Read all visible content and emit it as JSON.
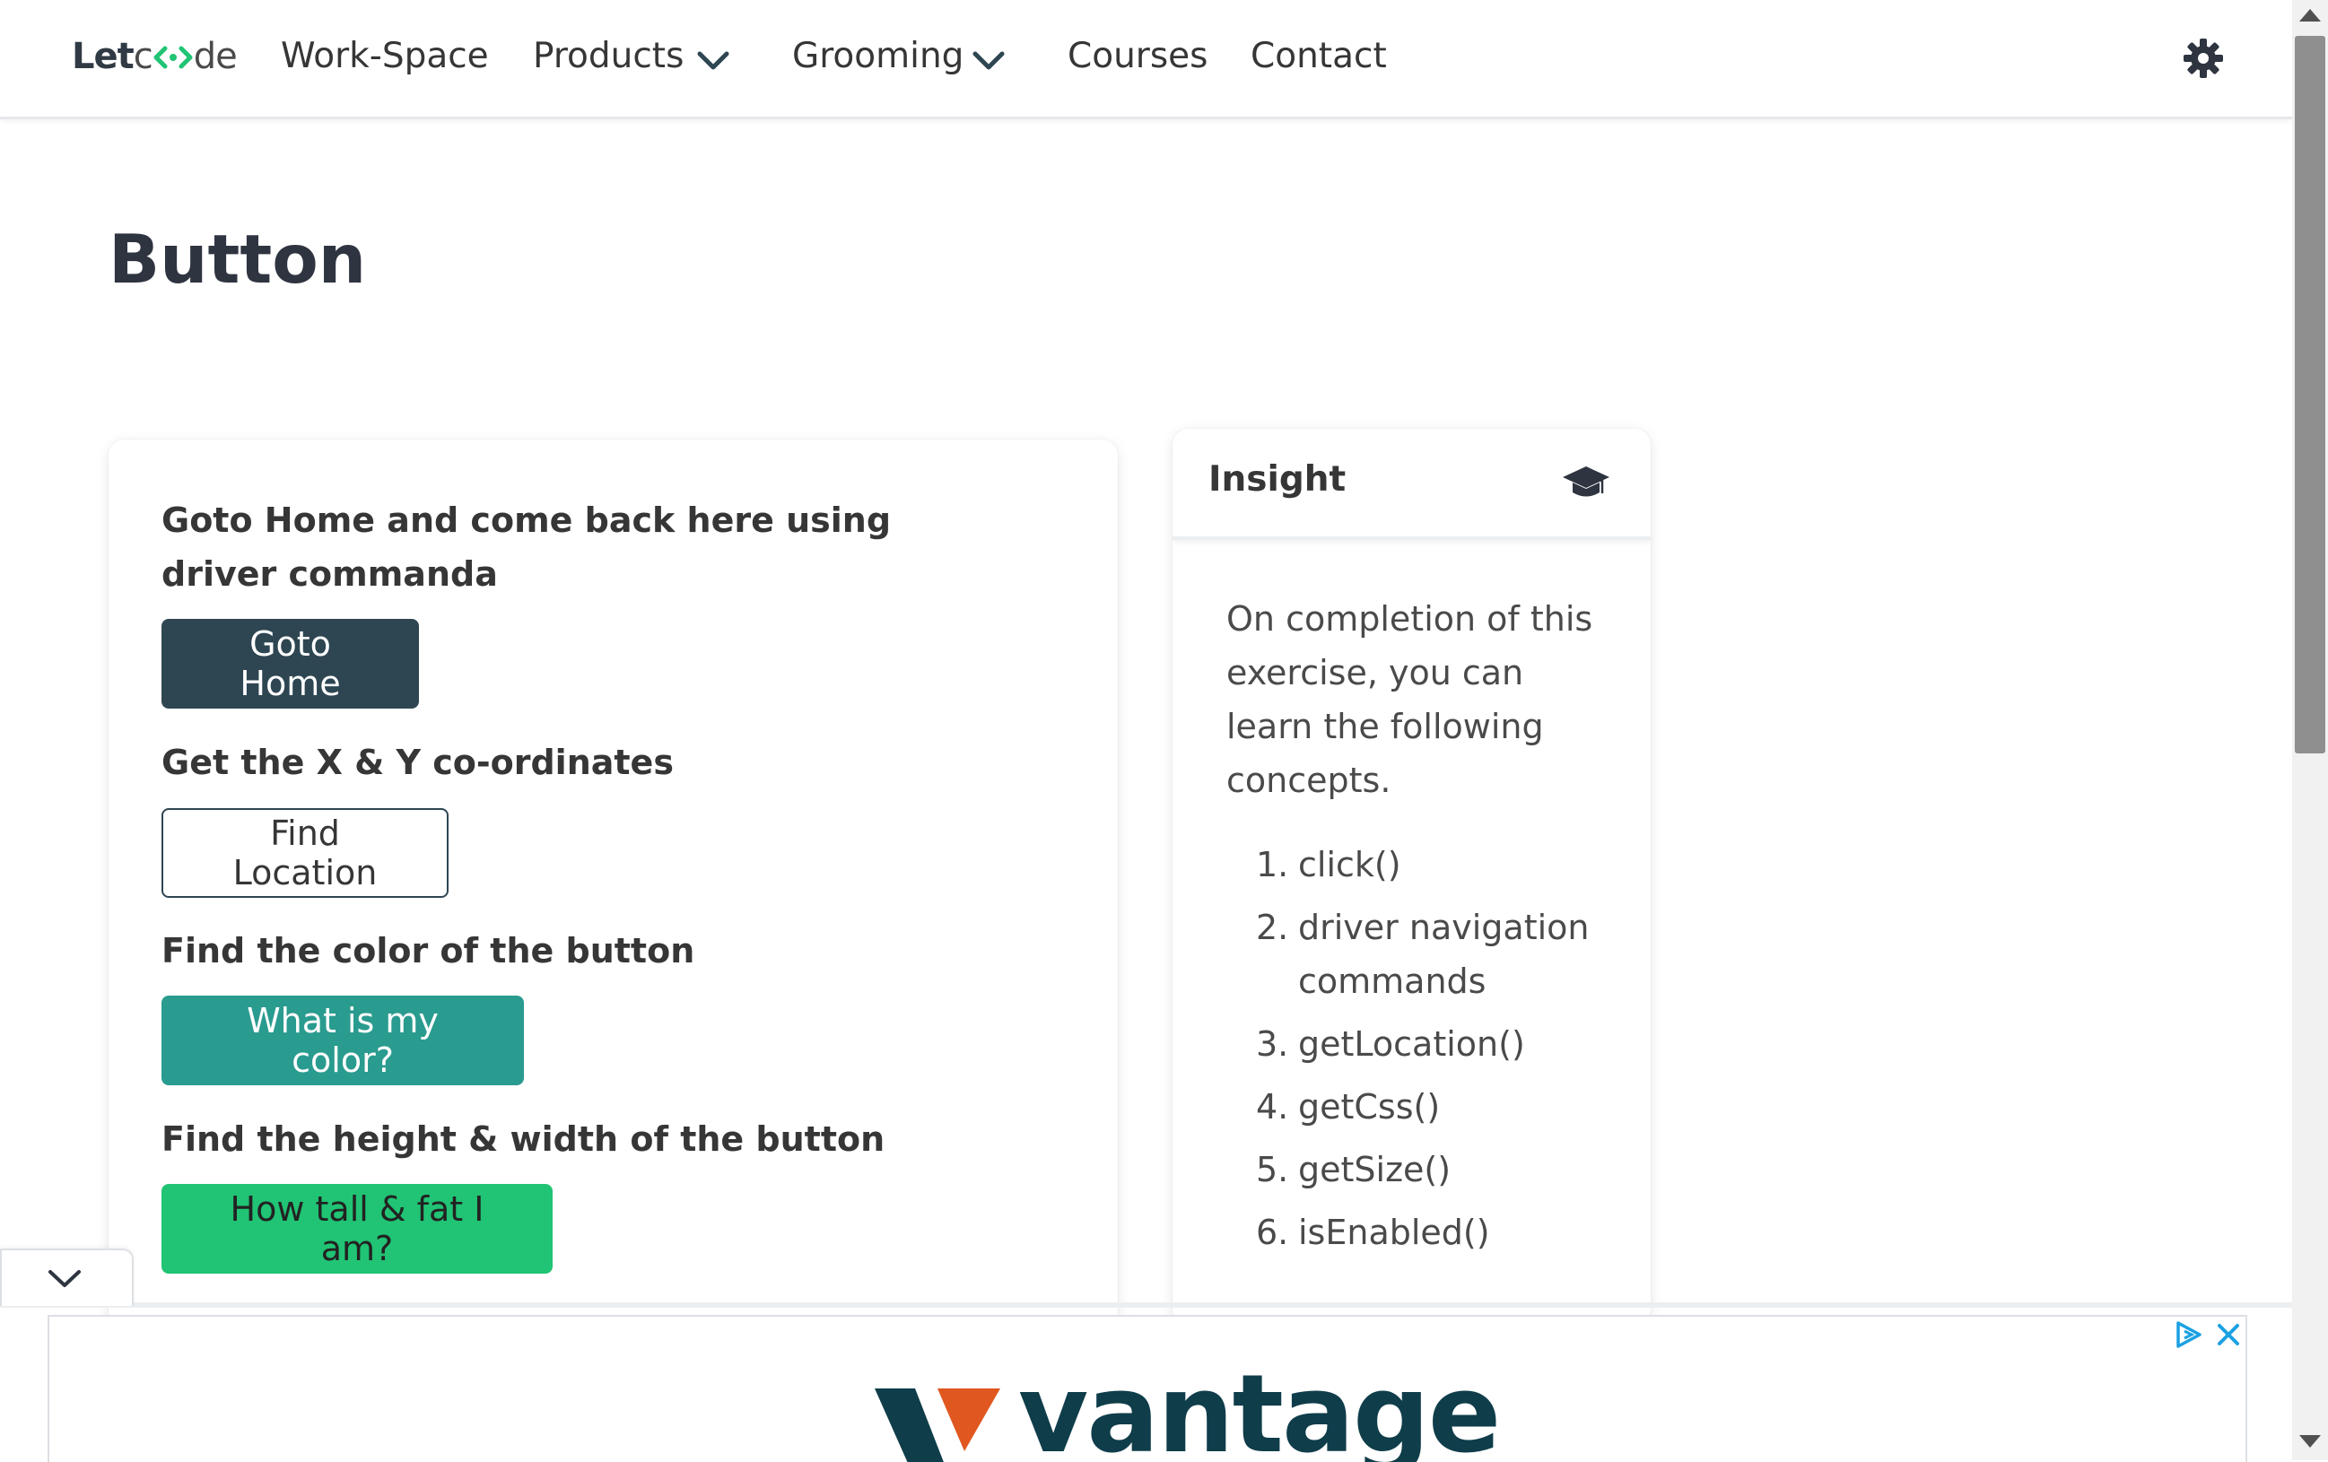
{
  "nav": {
    "brand_bold": "Let",
    "brand_rest": "de",
    "brand_full": "Letcode",
    "items": [
      {
        "label": "Work-Space"
      },
      {
        "label": "Products"
      },
      {
        "label": "Grooming"
      },
      {
        "label": "Courses"
      },
      {
        "label": "Contact"
      }
    ]
  },
  "page": {
    "title": "Button"
  },
  "exercises": {
    "q1": "Goto Home and come back here using driver commanda",
    "btn1": "Goto Home",
    "q2": "Get the X & Y co-ordinates",
    "btn2": "Find Location",
    "q3": "Find the color of the button",
    "btn3": "What is my color?",
    "q4": "Find the height & width of the button",
    "btn4": "How tall & fat I am?"
  },
  "insight": {
    "title": "Insight",
    "intro": "On completion of this exercise, you can learn the following concepts.",
    "items": [
      {
        "num": "1.",
        "text": "click()"
      },
      {
        "num": "2.",
        "text": "driver navigation commands"
      },
      {
        "num": "3.",
        "text": "getLocation()"
      },
      {
        "num": "4.",
        "text": "getCss()"
      },
      {
        "num": "5.",
        "text": "getSize()"
      },
      {
        "num": "6.",
        "text": "isEnabled()"
      }
    ]
  },
  "ad": {
    "brand": "vantage"
  },
  "colors": {
    "btn_home": "#2e4652",
    "btn_color": "#2a9b8f",
    "btn_size": "#20c474",
    "brand_accent": "#20c474"
  },
  "icons": {
    "theme_toggle": "gear-icon",
    "insight": "graduation-cap-icon",
    "collapse": "chevron-down-icon",
    "ad_choices": "ad-choices-icon",
    "ad_close": "close-icon"
  }
}
